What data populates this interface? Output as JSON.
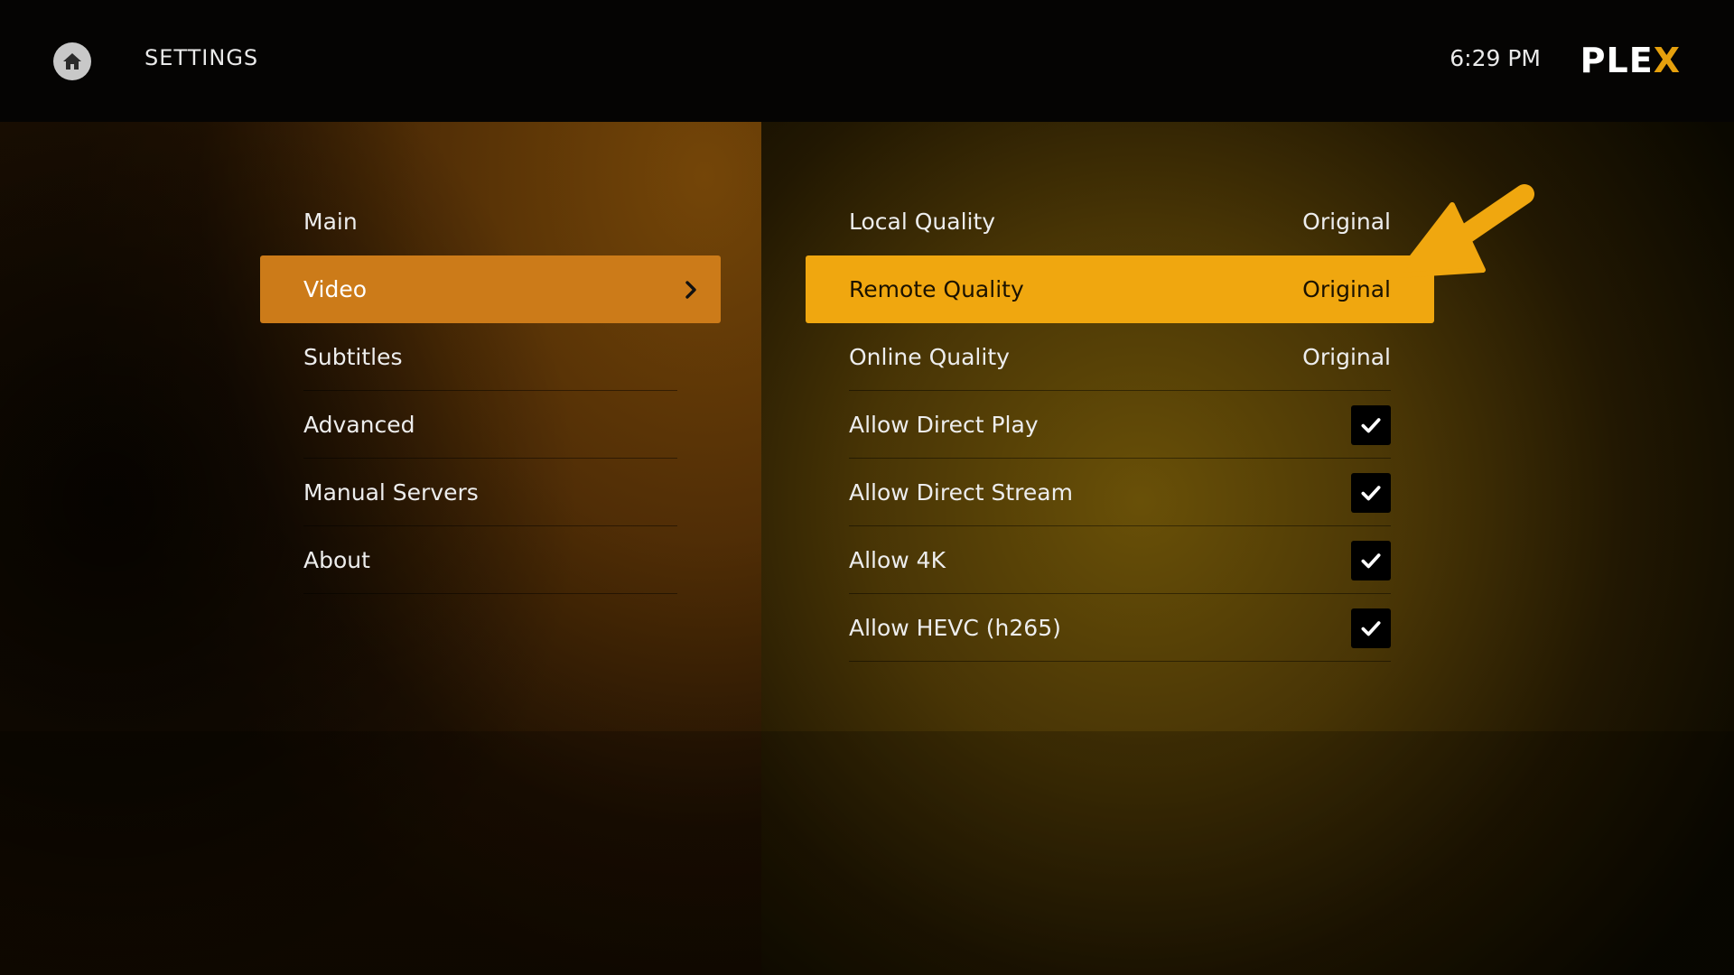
{
  "topbar": {
    "title": "SETTINGS",
    "time": "6:29 PM",
    "logo_main": "PLE",
    "logo_accent": "X",
    "home_icon": "home-icon"
  },
  "menu": {
    "items": [
      {
        "label": "Main",
        "active": false
      },
      {
        "label": "Video",
        "active": true
      },
      {
        "label": "Subtitles",
        "active": false
      },
      {
        "label": "Advanced",
        "active": false
      },
      {
        "label": "Manual Servers",
        "active": false
      },
      {
        "label": "About",
        "active": false
      }
    ]
  },
  "settings": {
    "rows": [
      {
        "label": "Local Quality",
        "value": "Original",
        "type": "value",
        "active": false
      },
      {
        "label": "Remote Quality",
        "value": "Original",
        "type": "value",
        "active": true
      },
      {
        "label": "Online Quality",
        "value": "Original",
        "type": "value",
        "active": false
      },
      {
        "label": "Allow Direct Play",
        "type": "checkbox",
        "checked": true
      },
      {
        "label": "Allow Direct Stream",
        "type": "checkbox",
        "checked": true
      },
      {
        "label": "Allow 4K",
        "type": "checkbox",
        "checked": true
      },
      {
        "label": "Allow HEVC (h265)",
        "type": "checkbox",
        "checked": true
      }
    ]
  },
  "colors": {
    "menu_active": "#cc7b19",
    "row_active": "#f0a70f",
    "brand_accent": "#e5a00d",
    "annotation_arrow": "#f0a70f"
  }
}
